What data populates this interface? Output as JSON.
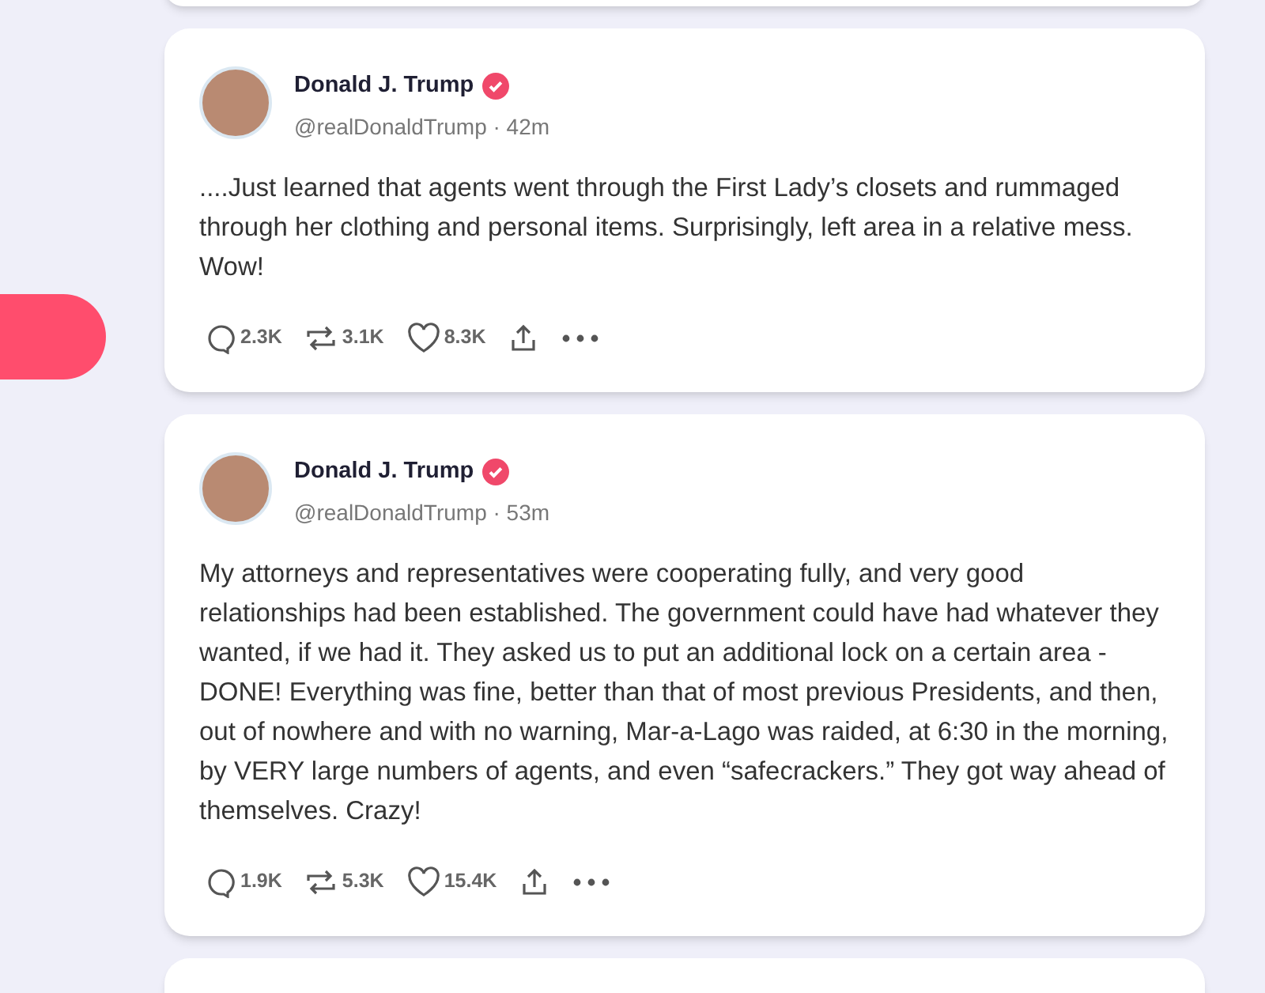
{
  "posts": [
    {
      "author": "Donald J. Trump",
      "verified": true,
      "byline": "@realDonaldTrump · 42m",
      "text": "....Just learned that agents went through the First Lady’s closets and rummaged through her clothing and personal items. Surprisingly, left area in a relative mess. Wow!",
      "replies": "2.3K",
      "reposts": "3.1K",
      "likes": "8.3K"
    },
    {
      "author": "Donald J. Trump",
      "verified": true,
      "byline": "@realDonaldTrump · 53m",
      "text": "My attorneys and representatives were cooperating fully, and very good relationships had been established. The government could have had whatever they wanted, if we had it. They asked us to put an additional lock on a certain area - DONE! Everything was fine, better than that of most previous Presidents, and then, out of nowhere and with no warning, Mar-a-Lago was raided, at 6:30 in the morning, by VERY large numbers of agents, and even “safecrackers.” They got way ahead of themselves. Crazy!",
      "replies": "1.9K",
      "reposts": "5.3K",
      "likes": "15.4K"
    }
  ]
}
